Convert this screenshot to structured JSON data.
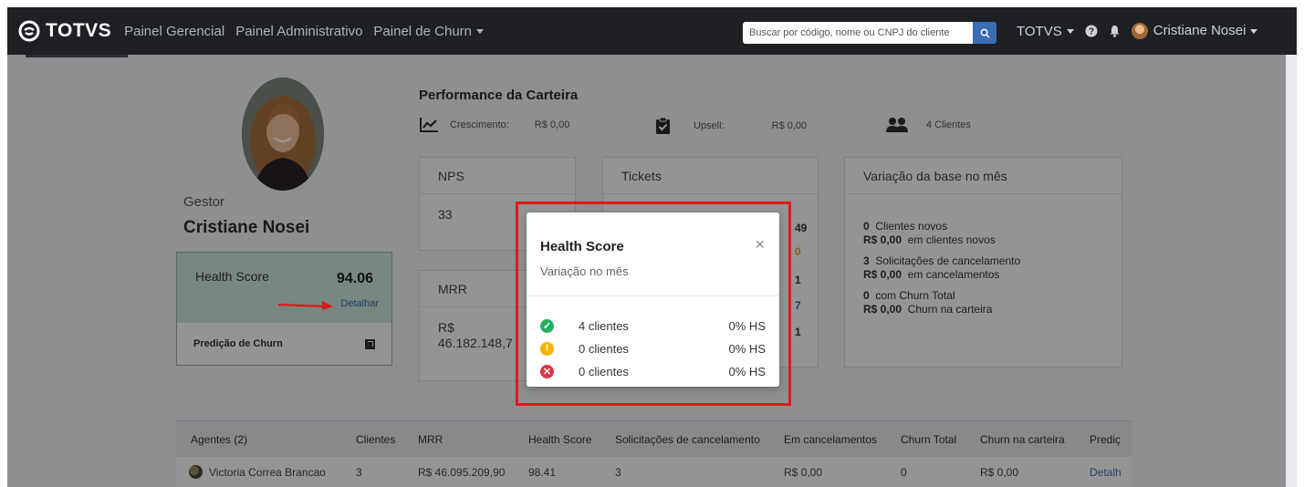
{
  "nav": {
    "brand": "TOTVS",
    "links": [
      "Painel Gerencial",
      "Painel Administrativo",
      "Painel de Churn"
    ],
    "search_placeholder": "Buscar por código, nome ou CNPJ do cliente",
    "org": "TOTVS",
    "user": "Cristiane Nosei"
  },
  "profile": {
    "role": "Gestor",
    "name": "Cristiane Nosei",
    "health_score_label": "Health Score",
    "health_score_value": "94.06",
    "detail_link": "Detalhar",
    "churn_prediction": "Predição de Churn"
  },
  "performance": {
    "title": "Performance da Carteira",
    "growth_label": "Crescimento:",
    "growth_value": "R$ 0,00",
    "upsell_label": "Upsell:",
    "upsell_value": "R$ 0,00",
    "clients": "4 Clientes"
  },
  "cards": {
    "nps": {
      "title": "NPS",
      "value": "33"
    },
    "mrr": {
      "title": "MRR",
      "value_line1": "R$",
      "value_line2": "46.182.148,7"
    },
    "tickets": {
      "title": "Tickets",
      "numbers": [
        "49",
        "0",
        "1",
        "7",
        "1"
      ]
    },
    "variation": {
      "title": "Variação da base no mês",
      "groups": [
        {
          "count": "0",
          "count_text": "Clientes novos",
          "amount": "R$ 0,00",
          "amount_text": "em clientes novos"
        },
        {
          "count": "3",
          "count_text": "Solicitações de cancelamento",
          "amount": "R$ 0,00",
          "amount_text": "em cancelamentos"
        },
        {
          "count": "0",
          "count_text": "com Churn Total",
          "amount": "R$ 0,00",
          "amount_text": "Churn na carteira"
        }
      ]
    }
  },
  "modal": {
    "title": "Health Score",
    "subtitle": "Variação no mês",
    "rows": [
      {
        "label": "4 clientes",
        "pct": "0% HS",
        "status": "good",
        "icon": "check-icon",
        "color": "#27ae60",
        "glyph": "✓"
      },
      {
        "label": "0 clientes",
        "pct": "0% HS",
        "status": "warning",
        "icon": "exclamation-icon",
        "color": "#f5b301",
        "glyph": "!"
      },
      {
        "label": "0 clientes",
        "pct": "0% HS",
        "status": "danger",
        "icon": "x-icon",
        "color": "#dc3545",
        "glyph": "✕"
      }
    ]
  },
  "table": {
    "headers": [
      "Agentes (2)",
      "Clientes",
      "MRR",
      "Health Score",
      "Solicitações de cancelamento",
      "Em cancelamentos",
      "Churn Total",
      "Churn na carteira",
      "Prediç"
    ],
    "rows": [
      [
        "Victoria Correa Brancao",
        "3",
        "R$ 46.095.209,90",
        "98.41",
        "3",
        "R$ 0,00",
        "0",
        "R$ 0,00",
        "Detalh"
      ]
    ]
  },
  "colors": {
    "navbar": "#1e2024",
    "health_card": "#cfe9de",
    "link": "#3a6fb7",
    "highlight": "#e0191b"
  }
}
